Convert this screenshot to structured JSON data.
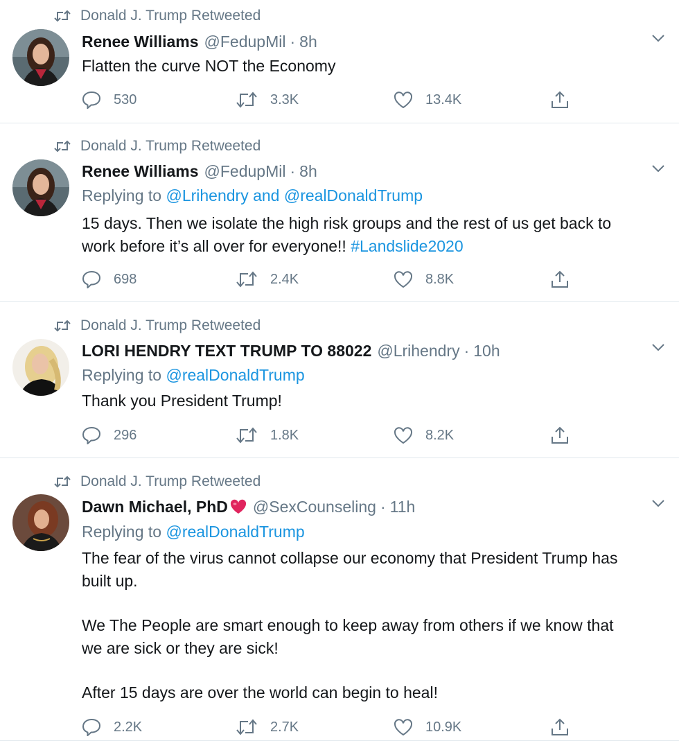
{
  "tweets": [
    {
      "retweeted_by": "Donald J. Trump Retweeted",
      "name": "Renee Williams",
      "handle": "@FedupMil",
      "time": "8h",
      "replying_prefix": "",
      "replying_targets": "",
      "text": [
        "Flatten the curve NOT the Economy"
      ],
      "replies": "530",
      "retweets": "3.3K",
      "likes": "13.4K"
    },
    {
      "retweeted_by": "Donald J. Trump Retweeted",
      "name": "Renee Williams",
      "handle": "@FedupMil",
      "time": "8h",
      "replying_prefix": "Replying to ",
      "replying_targets": "@Lrihendry and @realDonaldTrump",
      "text_line1": "15 days. Then we isolate the high risk groups and the rest of us get back to",
      "text_line2_plain": "work before it’s all over for everyone!! ",
      "text_hashtag": "#Landslide2020",
      "replies": "698",
      "retweets": "2.4K",
      "likes": "8.8K"
    },
    {
      "retweeted_by": "Donald J. Trump Retweeted",
      "name": "LORI HENDRY TEXT TRUMP TO 88022",
      "handle": "@Lrihendry",
      "time": "10h",
      "replying_prefix": "Replying to ",
      "replying_targets": "@realDonaldTrump",
      "text": [
        "Thank you President Trump!"
      ],
      "replies": "296",
      "retweets": "1.8K",
      "likes": "8.2K"
    },
    {
      "retweeted_by": "Donald J. Trump Retweeted",
      "name": "Dawn Michael, PhD",
      "handle": "@SexCounseling",
      "time": "11h",
      "replying_prefix": "Replying to ",
      "replying_targets": "@realDonaldTrump",
      "text": [
        "The fear of the virus cannot collapse our economy that President Trump has",
        "built up.",
        "We The People are smart enough to keep away from others if we know that",
        "we are sick or they are sick!",
        "After 15 days are over the world can begin to heal!"
      ],
      "replies": "2.2K",
      "retweets": "2.7K",
      "likes": "10.9K"
    }
  ],
  "separator": "·",
  "colors": {
    "text": "#14171a",
    "secondary": "#657786",
    "link": "#1b95e0",
    "divider": "#e1e8ed",
    "heart_emoji": "#e0245e"
  },
  "icons": [
    "retweet-icon",
    "reply-icon",
    "like-icon",
    "share-icon",
    "chevron-down-icon",
    "heart-emoji-icon"
  ]
}
